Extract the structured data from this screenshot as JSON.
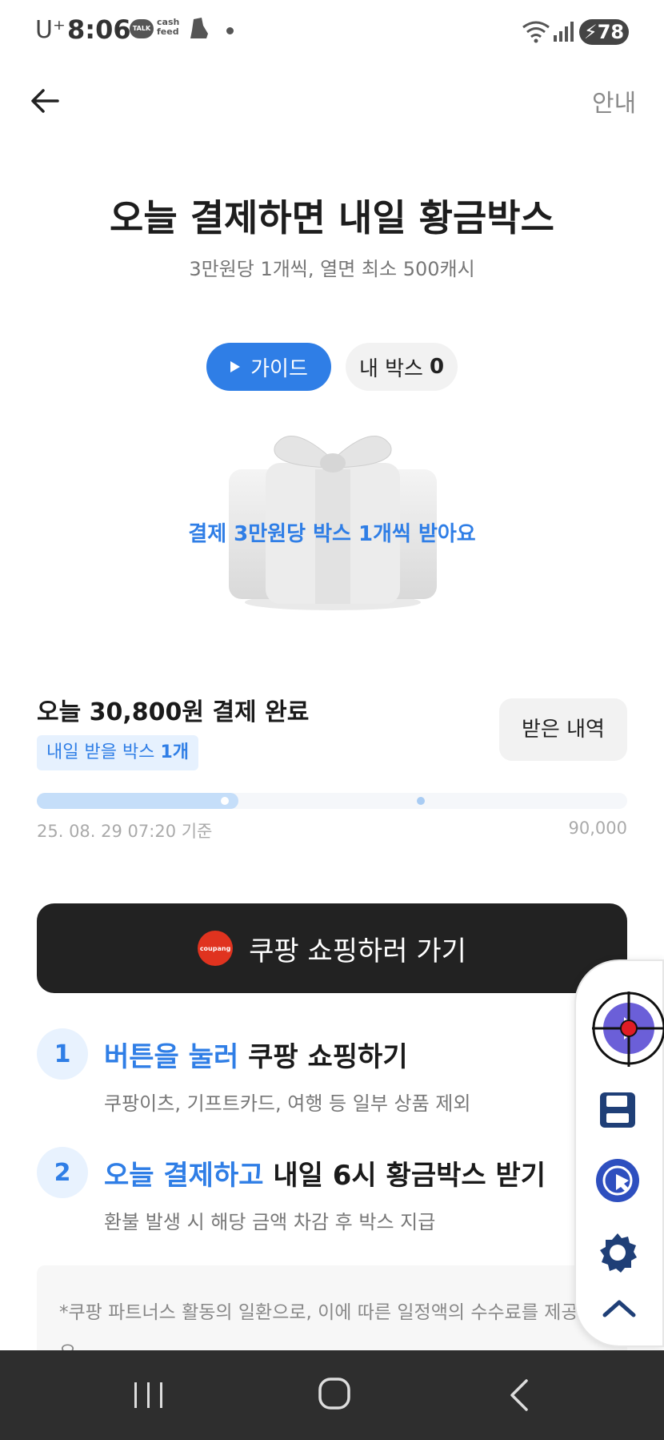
{
  "status_bar": {
    "carrier": "U⁺",
    "time": "8:06",
    "talk_badge": "TALK",
    "cashfeed_line1": "cash",
    "cashfeed_line2": "feed",
    "battery": "78"
  },
  "header": {
    "guide_link": "안내"
  },
  "hero": {
    "title": "오늘 결제하면 내일 황금박스",
    "subtitle": "3만원당 1개씩, 열면 최소 500캐시",
    "guide_button": "가이드",
    "my_box_label": "내 박스",
    "my_box_count": "0",
    "gift_caption": "결제 3만원당 박스 1개씩 받아요"
  },
  "payment": {
    "paid_text": "오늘 30,800원 결제 완료",
    "tomorrow_label": "내일 받을 박스",
    "tomorrow_count": "1개",
    "history_button": "받은 내역",
    "progress": 0.342,
    "as_of": "25. 08. 29 07:20 기준",
    "max": "90,000"
  },
  "cta": {
    "logo": "coupang",
    "label": "쿠팡 쇼핑하러 가기"
  },
  "steps": [
    {
      "num": "1",
      "highlight": "버튼을 눌러",
      "rest": " 쿠팡 쇼핑하기",
      "desc": "쿠팡이츠, 기프트카드, 여행 등 일부 상품 제외"
    },
    {
      "num": "2",
      "highlight": "오늘 결제하고",
      "rest": " 내일 6시 황금박스 받기",
      "desc": "환불 발생 시 해당 금액 차감 후 박스 지급"
    }
  ],
  "notice": "*쿠팡 파트너스 활동의 일환으로, 이에 따른 일정액의 수수료를 제공받아요",
  "colors": {
    "accent": "#2f7ee6",
    "cta_bg": "#222222",
    "nav_bg": "#2e2e2e"
  }
}
